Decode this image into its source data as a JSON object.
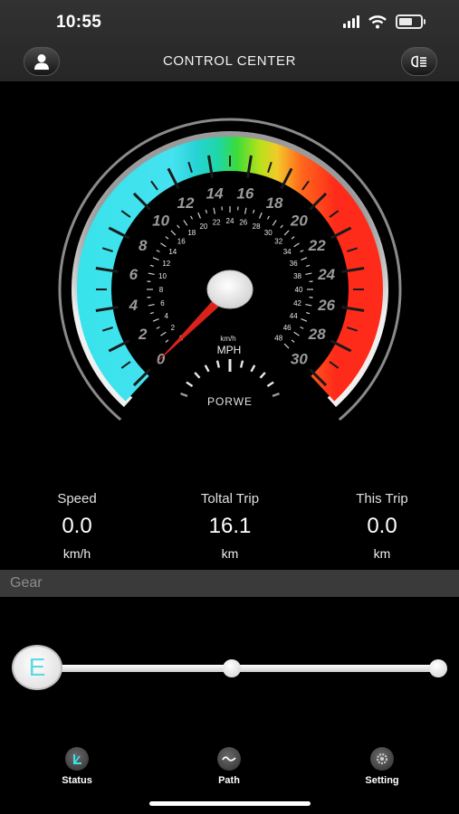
{
  "status_bar": {
    "time": "10:55"
  },
  "header": {
    "title": "CONTROL CENTER"
  },
  "gauge": {
    "mph_labels": [
      "0",
      "2",
      "4",
      "6",
      "8",
      "10",
      "12",
      "14",
      "16",
      "18",
      "20",
      "22",
      "24",
      "26",
      "28",
      "30"
    ],
    "kmh_labels": [
      "0",
      "2",
      "4",
      "6",
      "8",
      "10",
      "12",
      "14",
      "16",
      "18",
      "20",
      "22",
      "24",
      "26",
      "28",
      "30",
      "32",
      "34",
      "36",
      "38",
      "40",
      "42",
      "44",
      "46",
      "48"
    ],
    "unit_small": "km/h",
    "unit_big": "MPH",
    "power_label": "PORWE",
    "mph_value": 0,
    "mph_max": 30
  },
  "stats": [
    {
      "label": "Speed",
      "value": "0.0",
      "unit": "km/h"
    },
    {
      "label": "Toltal Trip",
      "value": "16.1",
      "unit": "km"
    },
    {
      "label": "This Trip",
      "value": "0.0",
      "unit": "km"
    }
  ],
  "gear": {
    "section_label": "Gear",
    "current": "E"
  },
  "tabs": [
    {
      "label": "Status",
      "icon": "status-icon"
    },
    {
      "label": "Path",
      "icon": "path-icon"
    },
    {
      "label": "Setting",
      "icon": "setting-icon"
    }
  ],
  "colors": {
    "cyan": "#39e3ec",
    "red": "#ff2b1a",
    "needle": "#d9231a",
    "gear_letter": "#5fd9df"
  }
}
